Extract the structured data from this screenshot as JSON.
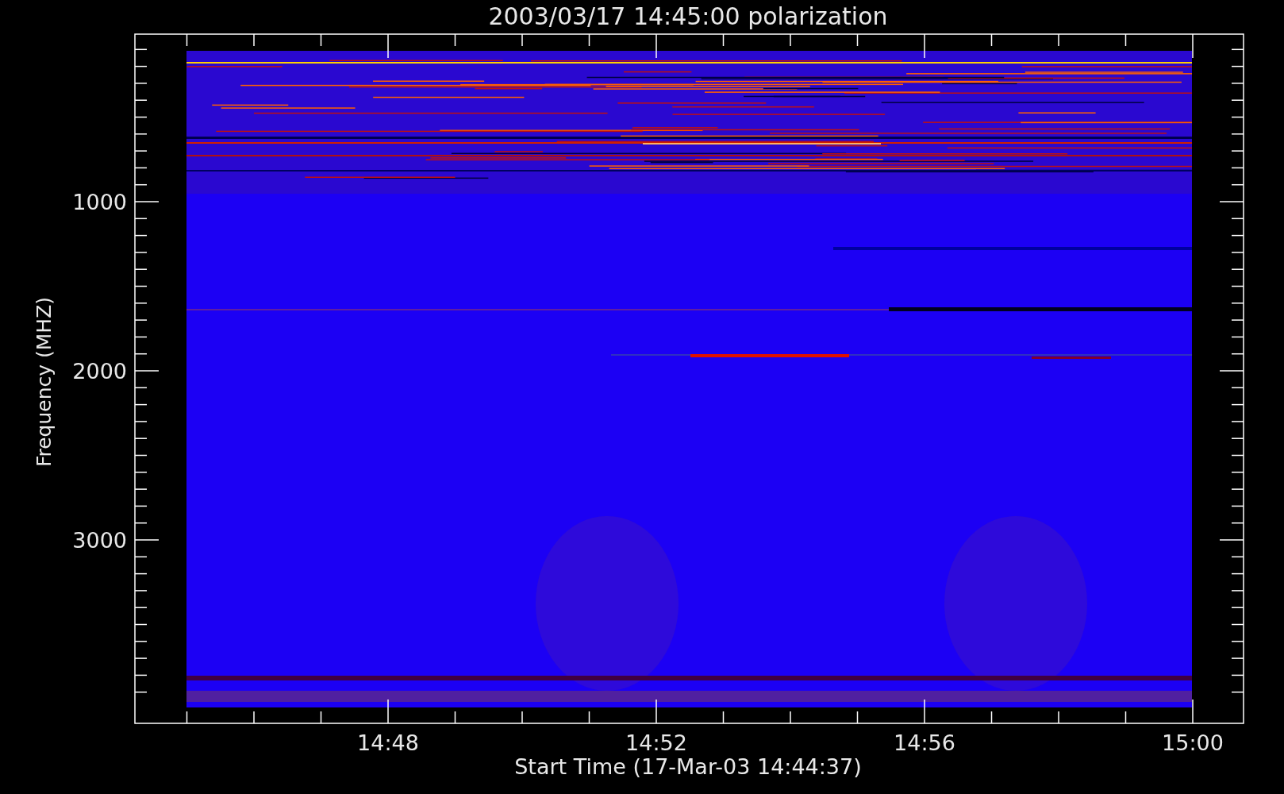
{
  "title": "2003/03/17 14:45:00 polarization",
  "y_axis": {
    "label": "Frequency (MHZ)",
    "ticks": [
      "1000",
      "2000",
      "3000"
    ]
  },
  "x_axis": {
    "label": "Start Time (17-Mar-03 14:44:37)",
    "ticks": [
      "14:48",
      "14:52",
      "14:56",
      "15:00"
    ]
  }
}
